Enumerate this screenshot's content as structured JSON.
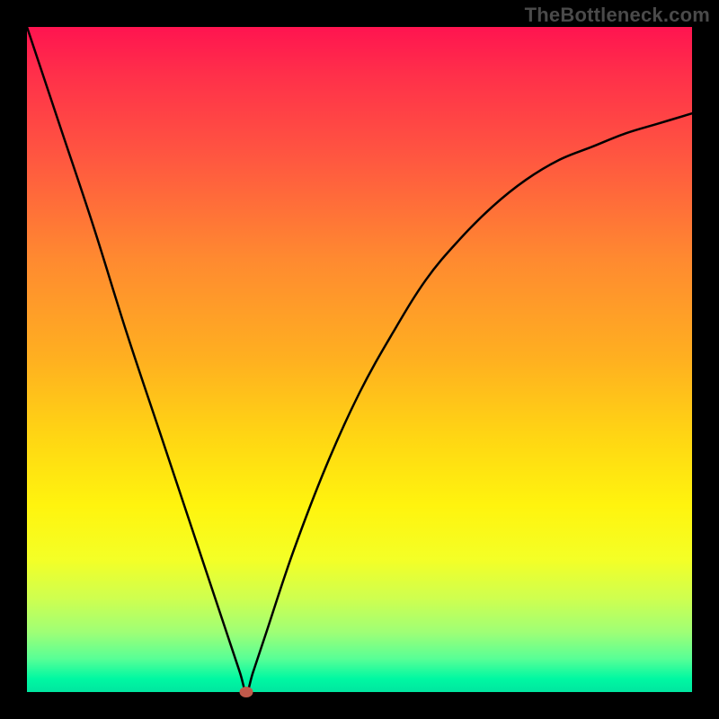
{
  "watermark": "TheBottleneck.com",
  "colors": {
    "frame": "#000000",
    "curve": "#000000",
    "marker": "#c1594b",
    "gradient_stops": [
      {
        "pos": 0,
        "hex": "#ff1450"
      },
      {
        "pos": 7,
        "hex": "#ff2f4a"
      },
      {
        "pos": 20,
        "hex": "#ff5840"
      },
      {
        "pos": 35,
        "hex": "#ff8a30"
      },
      {
        "pos": 50,
        "hex": "#ffb020"
      },
      {
        "pos": 62,
        "hex": "#ffd713"
      },
      {
        "pos": 72,
        "hex": "#fff40e"
      },
      {
        "pos": 80,
        "hex": "#f4ff26"
      },
      {
        "pos": 86,
        "hex": "#ceff50"
      },
      {
        "pos": 91,
        "hex": "#9fff76"
      },
      {
        "pos": 95,
        "hex": "#58ff96"
      },
      {
        "pos": 98,
        "hex": "#00f8a2"
      },
      {
        "pos": 100,
        "hex": "#00e6a0"
      }
    ]
  },
  "chart_data": {
    "type": "line",
    "title": "",
    "xlabel": "",
    "ylabel": "",
    "xlim": [
      0,
      100
    ],
    "ylim": [
      0,
      100
    ],
    "grid": false,
    "legend": false,
    "notes": "Bottleneck-style V curve on red→green vertical gradient. Axes unlabeled; values are percentages of the plot-area width/height estimated from pixels.",
    "series": [
      {
        "name": "bottleneck-curve",
        "x": [
          0,
          5,
          10,
          15,
          20,
          25,
          30,
          32,
          33,
          34,
          36,
          40,
          45,
          50,
          55,
          60,
          65,
          70,
          75,
          80,
          85,
          90,
          95,
          100
        ],
        "y": [
          100,
          85,
          70,
          54,
          39,
          24,
          9,
          3,
          0,
          3,
          9,
          21,
          34,
          45,
          54,
          62,
          68,
          73,
          77,
          80,
          82,
          84,
          85.5,
          87
        ]
      }
    ],
    "marker": {
      "x": 33,
      "y": 0,
      "color": "#c1594b"
    }
  }
}
